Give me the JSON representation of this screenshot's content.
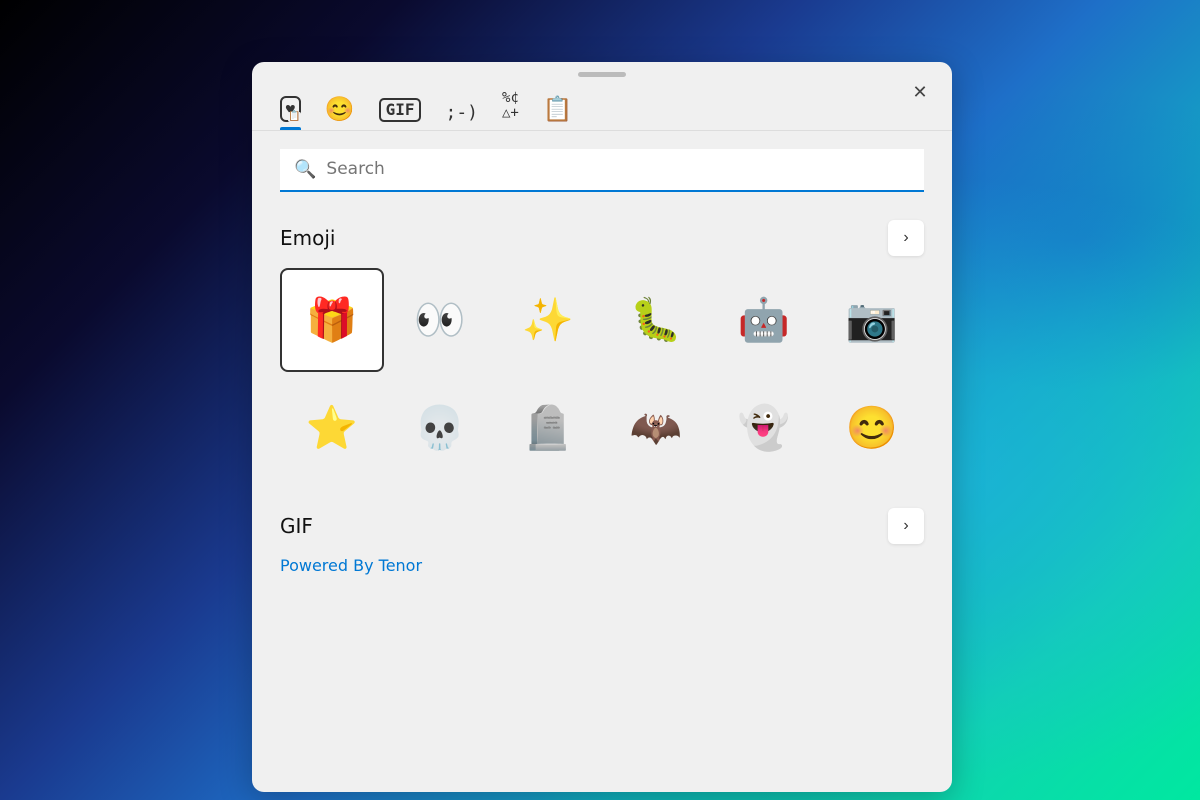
{
  "background": {
    "desc": "Windows 11 blue swirl wallpaper"
  },
  "panel": {
    "close_label": "✕",
    "drag_handle": "drag-handle"
  },
  "tabs": [
    {
      "id": "favorites",
      "icon": "🗂",
      "icon_unicode": "🗃",
      "label": "Favorites",
      "active": true,
      "icon_display": "📋♥"
    },
    {
      "id": "emoji",
      "icon": "😊",
      "label": "Emoji",
      "active": false
    },
    {
      "id": "gif",
      "icon": "GIF",
      "label": "GIF",
      "active": false,
      "text": true
    },
    {
      "id": "kaomoji",
      "icon": ";-)",
      "label": "Kaomoji",
      "active": false,
      "text": true
    },
    {
      "id": "symbols",
      "icon": "%¢△+",
      "label": "Symbols",
      "active": false,
      "text": true
    },
    {
      "id": "clipboard",
      "icon": "📋",
      "label": "Clipboard",
      "active": false
    }
  ],
  "search": {
    "placeholder": "Search",
    "icon": "🔍"
  },
  "emoji_section": {
    "title": "Emoji",
    "more_label": "›",
    "items": [
      {
        "emoji": "🎁",
        "label": "gift",
        "selected": true
      },
      {
        "emoji": "👀",
        "label": "eyes"
      },
      {
        "emoji": "✨",
        "label": "sparkles"
      },
      {
        "emoji": "🐛",
        "label": "caterpillar"
      },
      {
        "emoji": "🤖",
        "label": "robot"
      },
      {
        "emoji": "📷",
        "label": "camera"
      },
      {
        "emoji": "⭐",
        "label": "star"
      },
      {
        "emoji": "💀",
        "label": "skull"
      },
      {
        "emoji": "🪦",
        "label": "headstone"
      },
      {
        "emoji": "🦇",
        "label": "bat"
      },
      {
        "emoji": "👻",
        "label": "ghost"
      },
      {
        "emoji": "😊",
        "label": "smiling face"
      }
    ]
  },
  "gif_section": {
    "title": "GIF",
    "more_label": "›",
    "powered_by": "Powered By Tenor"
  }
}
